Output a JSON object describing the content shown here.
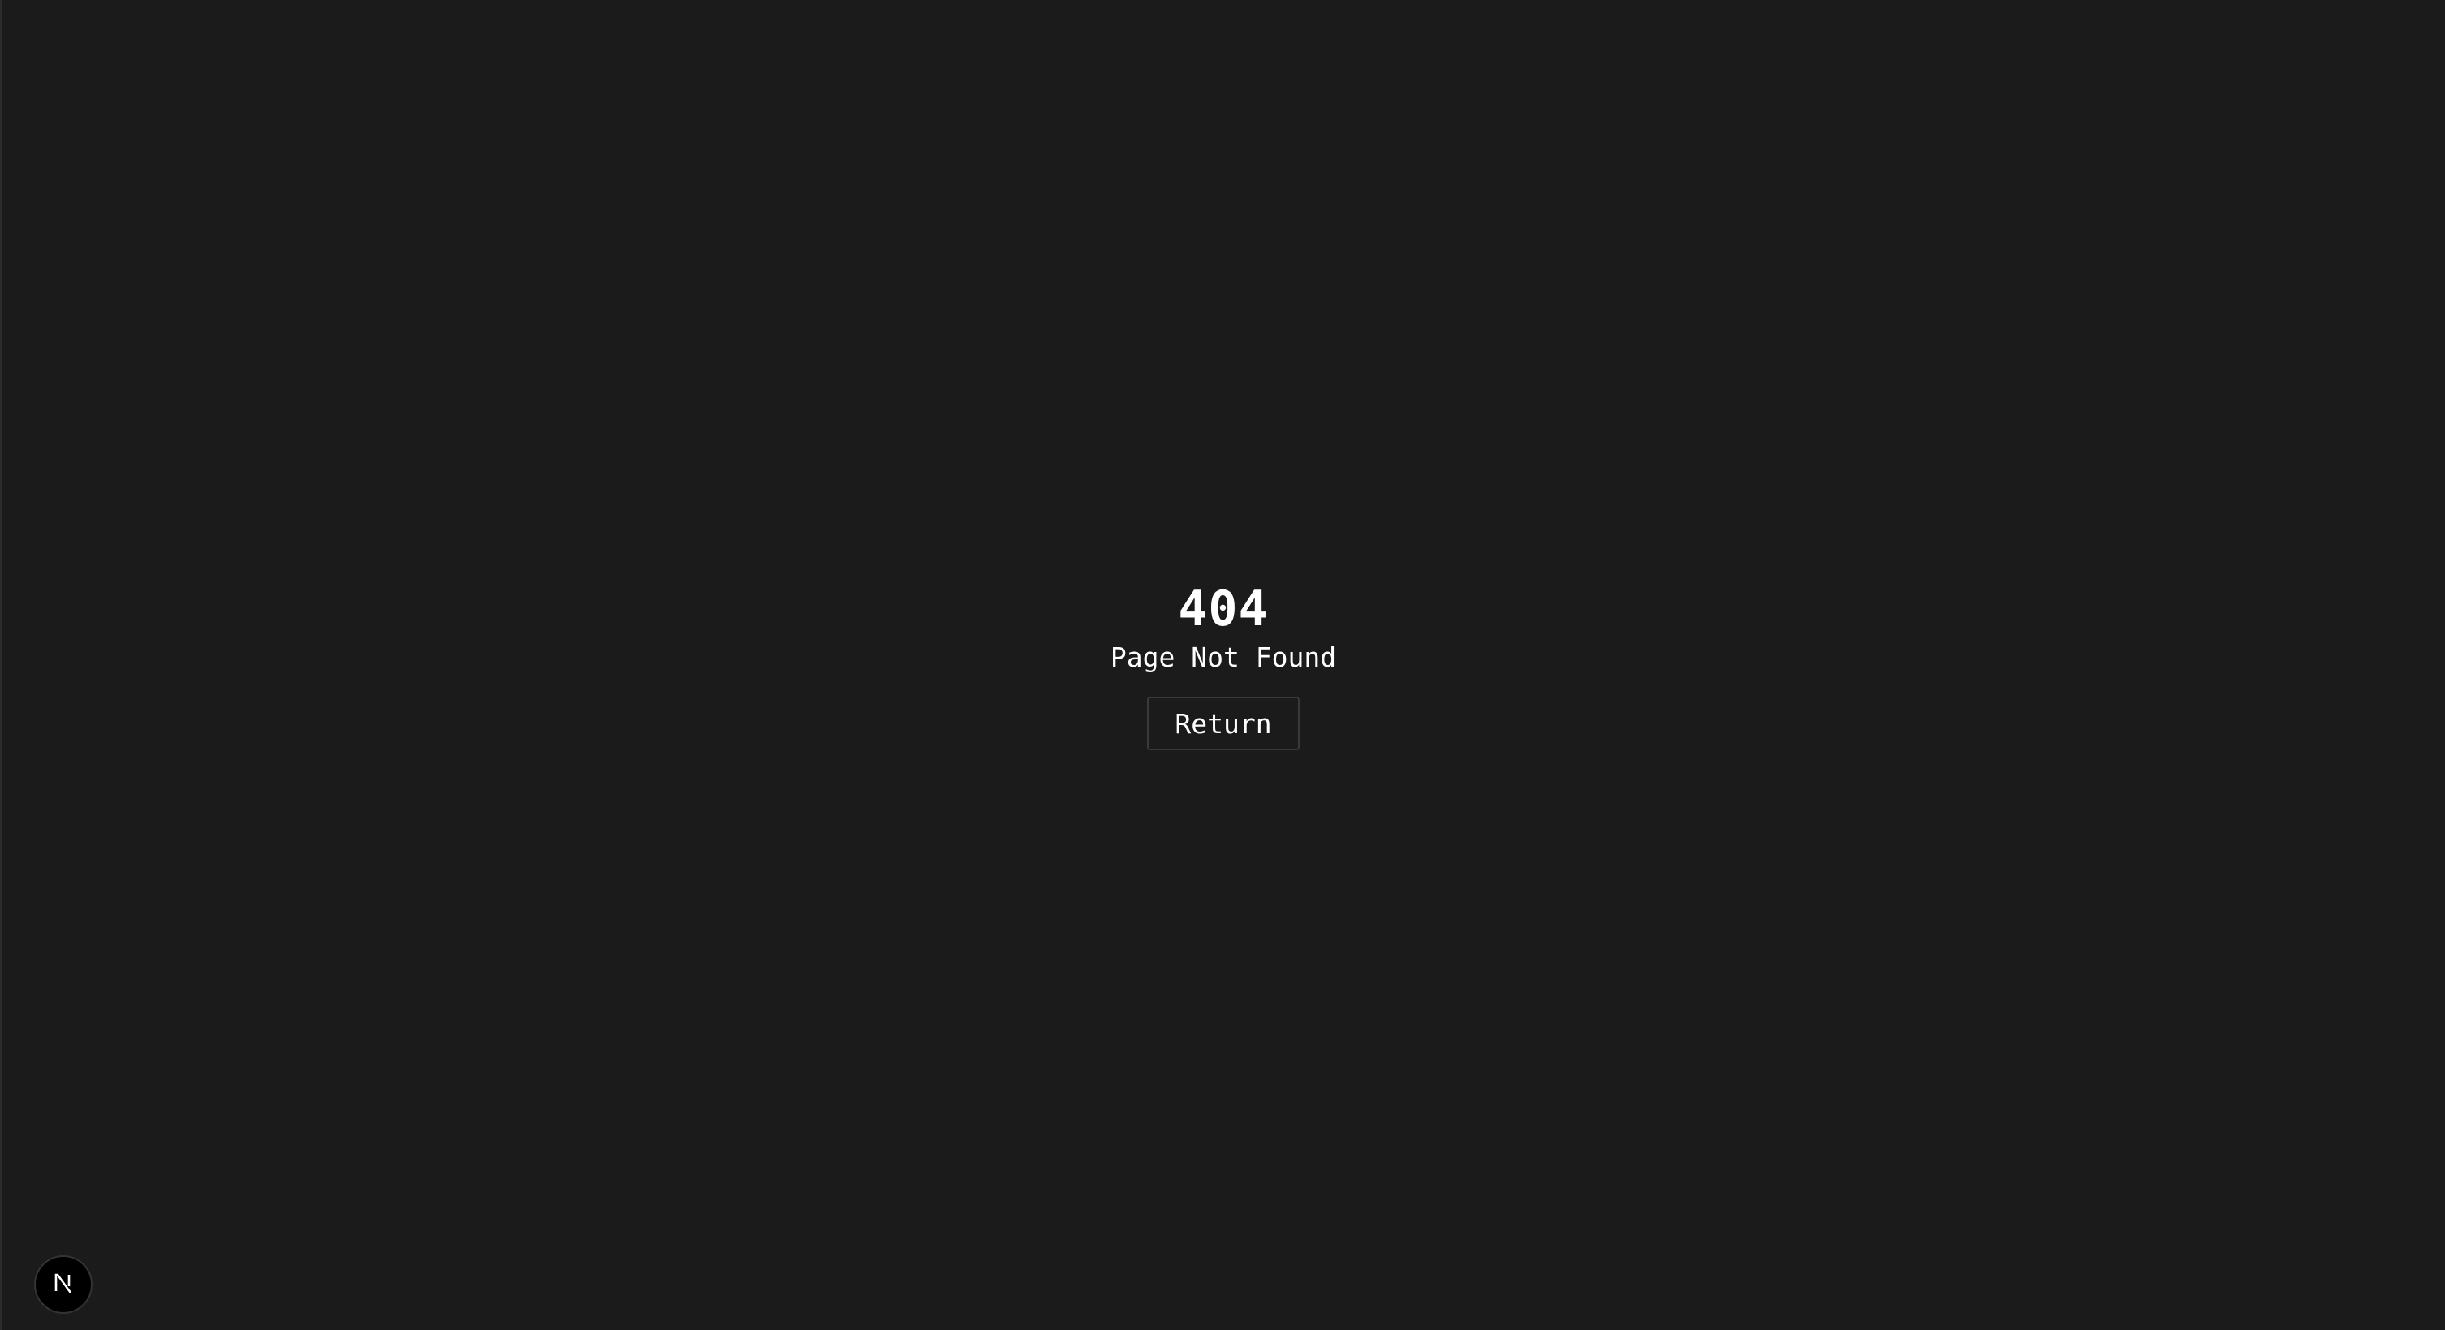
{
  "error": {
    "code": "404",
    "message": "Page Not Found",
    "return_label": "Return"
  },
  "dev_badge": {
    "icon": "nextjs-logo-icon"
  },
  "colors": {
    "background": "#1b1b1b",
    "text": "#ffffff",
    "button_border": "#3a3a3a"
  }
}
